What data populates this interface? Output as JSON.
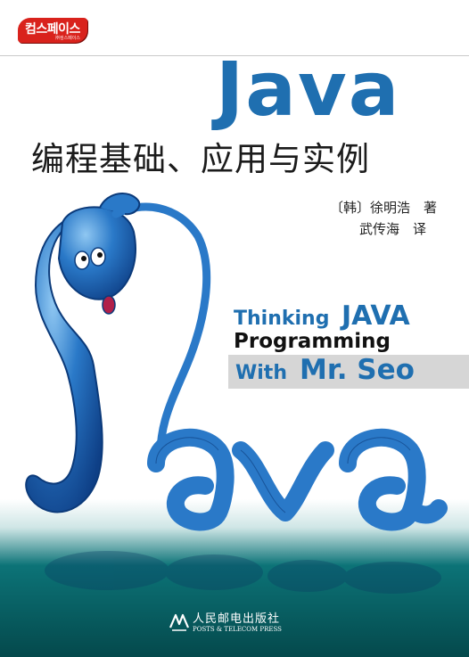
{
  "logo": {
    "main": "컴스페이스",
    "sub": "㈜컴스페이스"
  },
  "title": {
    "java": "Java",
    "chinese": "编程基础、应用与实例"
  },
  "authors": {
    "line1": "〔韩〕徐明浩　著",
    "line2": "武传海　译"
  },
  "subtitle": {
    "thinking": "Thinking",
    "java": "JAVA",
    "programming": "Programming",
    "with": "With",
    "mr_seo": "Mr. Seo"
  },
  "publisher": {
    "chinese": "人民邮电出版社",
    "english": "POSTS & TELECOM PRESS"
  },
  "colors": {
    "accent": "#1f6fb0",
    "logo_red": "#d9221c",
    "teal_band": "#0b6f74"
  },
  "icons": [
    "java-character-illustration",
    "publisher-logo-icon"
  ]
}
